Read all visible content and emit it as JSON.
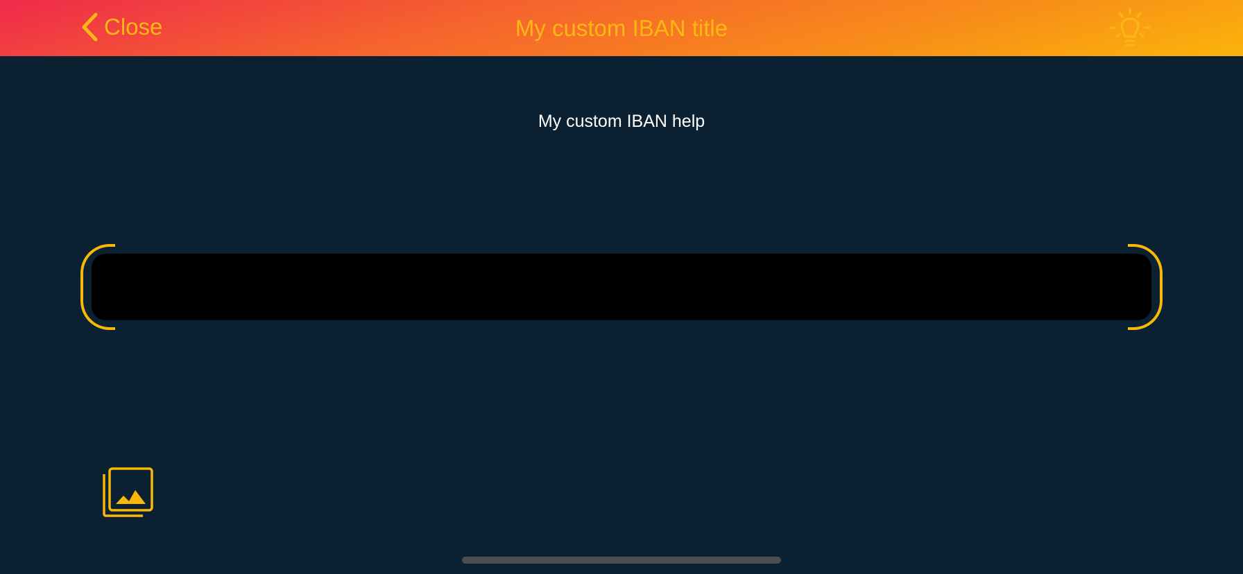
{
  "header": {
    "close_label": "Close",
    "title": "My custom IBAN title",
    "back_icon": "chevron-left-icon",
    "flash_icon": "lightbulb-icon"
  },
  "main": {
    "help_text": "My custom IBAN help"
  },
  "footer": {
    "gallery_icon": "photo-gallery-icon"
  },
  "colors": {
    "accent": "#fbb814",
    "background": "#0b2031",
    "header_gradient_start": "#ef2a4b",
    "header_gradient_end": "#fbb40a",
    "scan_area": "#000000",
    "home_indicator": "#4f4f4f"
  }
}
